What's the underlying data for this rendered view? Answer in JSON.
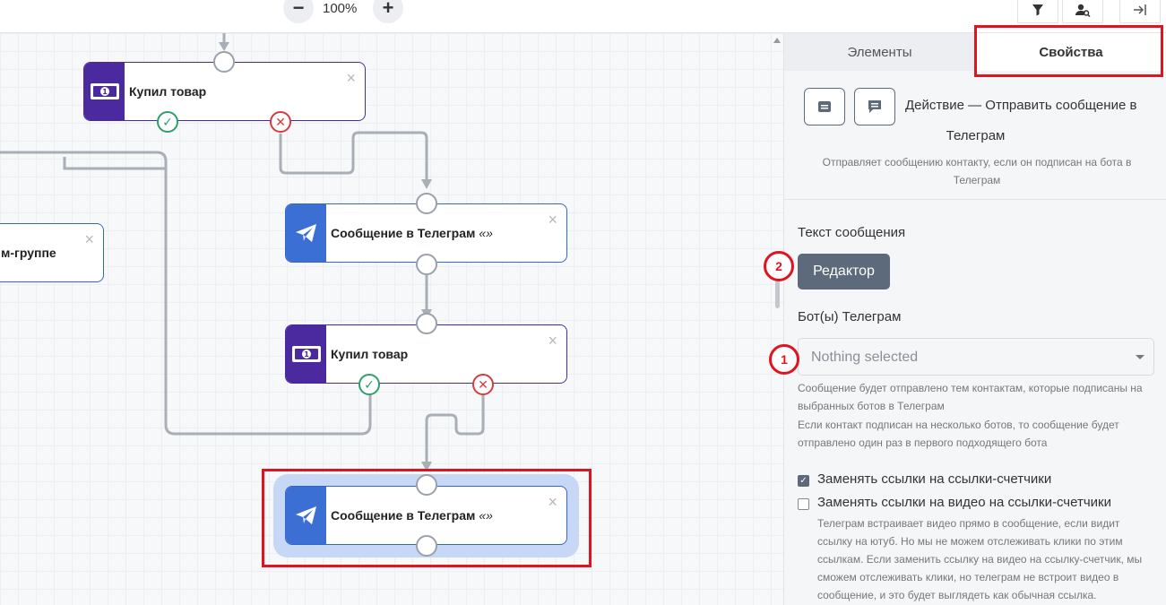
{
  "toolbar": {
    "zoom_out_icon": "minus-icon",
    "zoom_in_icon": "plus-icon",
    "zoom_level": "100%",
    "filter_icon": "filter-icon",
    "user_search_icon": "user-search-icon",
    "collapse_icon": "arrow-to-right-icon"
  },
  "canvas": {
    "nodes": [
      {
        "kind": "buy",
        "title": "Купил товар",
        "icon": "money-icon"
      },
      {
        "kind": "tg",
        "title": "Сообщение в Телеграм",
        "quote": "«»",
        "icon": "telegram-icon"
      },
      {
        "kind": "partial",
        "title": "м-группе"
      },
      {
        "kind": "buy",
        "title": "Купил товар",
        "icon": "money-icon"
      },
      {
        "kind": "tg",
        "title": "Сообщение в Телеграм",
        "quote": "«»",
        "icon": "telegram-icon",
        "selected": true
      }
    ],
    "close_glyph": "×",
    "ok_glyph": "✓",
    "no_glyph": "✕"
  },
  "panel": {
    "tabs": [
      {
        "label": "Элементы",
        "active": false
      },
      {
        "label": "Свойства",
        "active": true
      }
    ],
    "action_title": "Действие — Отправить сообщение в",
    "action_title_line2": "Телеграм",
    "action_description": "Отправляет сообщению контакту, если он подписан на бота в Телеграм",
    "message_text_label": "Текст сообщения",
    "editor_button": "Редактор",
    "bots_label": "Бот(ы) Телеграм",
    "bots_placeholder": "Nothing selected",
    "bots_help_1": "Сообщение будет отправлено тем контактам, которые подписаны на выбранных ботов в Телеграм",
    "bots_help_2": "Если контакт подписан на несколько ботов, то сообщение будет отправлено один раз в первого подходящего бота",
    "checkbox_links": {
      "label": "Заменять ссылки на ссылки-счетчики",
      "checked": true
    },
    "checkbox_video": {
      "label": "Заменять ссылки на видео на ссылки-счетчики",
      "checked": false
    },
    "video_help": "Телеграм встраивает видео прямо в сообщение, если видит ссылку на ютуб. Но мы не можем отслеживать клики по этим ссылкам. Если заменить ссылку на видео на ссылку-счетчик, мы сможем отслеживать клики, но телеграм не встроит видео в сообщение, и это будет выглядеть как обычная ссылка."
  },
  "annotations": {
    "badge_1": "1",
    "badge_2": "2",
    "highlight_color": "#e0141e"
  }
}
